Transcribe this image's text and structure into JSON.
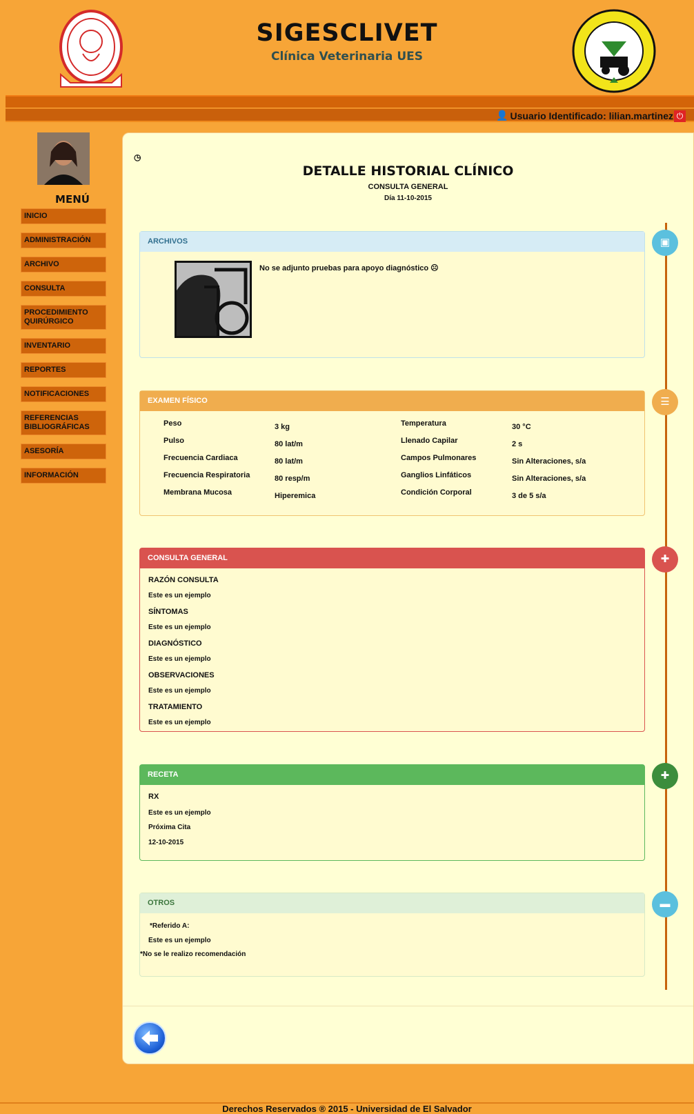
{
  "header": {
    "title": "SIGESCLIVET",
    "subtitle": "Clínica Veterinaria UES",
    "user_label": "Usuario Identificado: lilian.martinez"
  },
  "menu": {
    "title": "MENÚ",
    "items": [
      "INICIO",
      "ADMINISTRACIÓN",
      "ARCHIVO",
      "CONSULTA",
      "PROCEDIMIENTO QUIRÚRGICO",
      "INVENTARIO",
      "REPORTES",
      "NOTIFICACIONES",
      "REFERENCIAS BIBLIOGRÁFICAS",
      "ASESORÍA",
      "INFORMACIÓN"
    ]
  },
  "page": {
    "title": "DETALLE HISTORIAL CLÍNICO",
    "subtitle": "CONSULTA GENERAL",
    "date": "Día 11-10-2015"
  },
  "archivos": {
    "heading": "ARCHIVOS",
    "message": "No se adjunto pruebas para apoyo diagnóstico ☹"
  },
  "examen": {
    "heading": "EXAMEN FÍSICO",
    "left": [
      {
        "label": "Peso",
        "value": "3  kg"
      },
      {
        "label": "Pulso",
        "value": "80  lat/m"
      },
      {
        "label": "Frecuencia Cardiaca",
        "value": "80  lat/m"
      },
      {
        "label": "Frecuencia Respiratoria",
        "value": "80  resp/m"
      },
      {
        "label": "Membrana Mucosa",
        "value": "Hiperemica"
      }
    ],
    "right": [
      {
        "label": "Temperatura",
        "value": "30  °C"
      },
      {
        "label": "Llenado Capilar",
        "value": "2  s"
      },
      {
        "label": "Campos Pulmonares",
        "value": "Sin Alteraciones,  s/a"
      },
      {
        "label": "Ganglios Linfáticos",
        "value": "Sin Alteraciones,  s/a"
      },
      {
        "label": "Condición Corporal",
        "value": "3 de 5  s/a"
      }
    ]
  },
  "consulta": {
    "heading": "CONSULTA GENERAL",
    "sections": [
      {
        "label": "RAZÓN CONSULTA",
        "value": "Este es un ejemplo"
      },
      {
        "label": "SÍNTOMAS",
        "value": "Este es un ejemplo"
      },
      {
        "label": "DIAGNÓSTICO",
        "value": "Este es un ejemplo"
      },
      {
        "label": "OBSERVACIONES",
        "value": "Este es un ejemplo"
      },
      {
        "label": "TRATAMIENTO",
        "value": "Este es un ejemplo"
      }
    ]
  },
  "receta": {
    "heading": "RECETA",
    "rx_label": "RX",
    "rx_value": "Este es un ejemplo",
    "cita_label": "Próxima Cita",
    "cita_value": "12-10-2015"
  },
  "otros": {
    "heading": "OTROS",
    "ref_label": "*Referido A:",
    "ref_value": "Este es un ejemplo",
    "recomendacion": "*No se le realizo recomendación"
  },
  "footer": {
    "text": "Derechos Reservados ® 2015 - Universidad de El Salvador"
  }
}
